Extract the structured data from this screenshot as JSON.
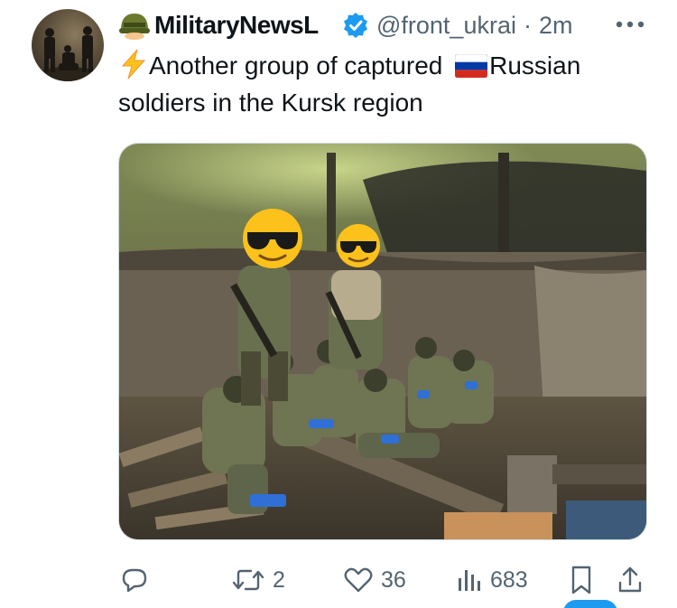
{
  "author": {
    "name": "MilitaryNewsL",
    "handle": "@front_ukrai",
    "separator": "·",
    "time": "2m",
    "name_emoji_icon": "military-helmet-emoji",
    "verified_badge_icon": "verified-badge-icon"
  },
  "tweet": {
    "text_part1": "Another group of captured ",
    "text_part2": "Russian soldiers in the Kursk region",
    "lead_emoji_icon": "lightning-emoji",
    "flag_emoji_icon": "russian-flag-emoji"
  },
  "actions": {
    "reply_count": "",
    "retweet_count": "2",
    "like_count": "36",
    "views_count": "683"
  },
  "colors": {
    "text": "#0f1419",
    "muted": "#536471",
    "accent": "#1d9bf0"
  }
}
